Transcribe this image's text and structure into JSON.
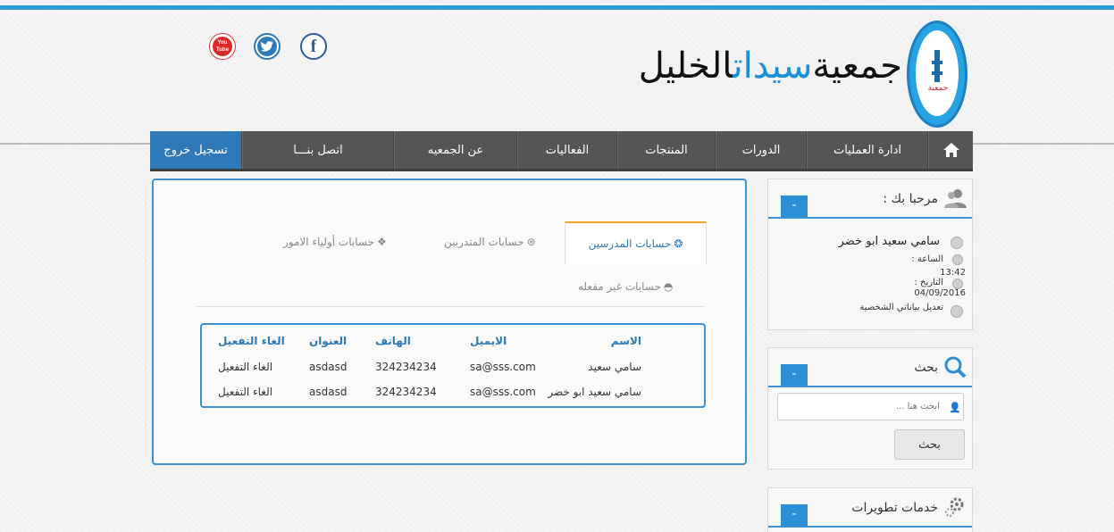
{
  "header": {
    "title_prefix": "جمعية",
    "title_accent": "سيدات",
    "title_suffix": "الخليل",
    "logo_text": "جمعية",
    "social": [
      "youtube-icon",
      "twitter-icon",
      "facebook-icon"
    ],
    "youtube_label_1": "You",
    "youtube_label_2": "Tube",
    "facebook_label": "f"
  },
  "nav": {
    "home_icon": "home-icon",
    "items": [
      "ادارة العمليات",
      "الدورات",
      "المنتجات",
      "الفعاليات",
      "عن الجمعيه",
      "اتصل بنـــا"
    ],
    "logout": "تسجيل خروج"
  },
  "colors": {
    "accent": "#2d8fd6",
    "nav_bg": "#555555",
    "tab_active_border": "#f0a32a"
  },
  "tabs": {
    "teachers": "حسابات المدرسين",
    "trainees": "حسابات المتدربين",
    "guardians": "حسابات أولياء الامور",
    "inactive": "حسابات غير مفعله"
  },
  "table": {
    "headers": {
      "name": "الاسم",
      "email": "الايميل",
      "phone": "الهاتف",
      "address": "العنوان",
      "deactivate": "الغاء التفعيل"
    },
    "rows": [
      {
        "name": "سامي سعيد",
        "email": "sa@sss.com",
        "phone": "324234234",
        "address": "asdasd",
        "deactivate": "الغاء التفعيل"
      },
      {
        "name": "سامي سعيد ابو خضر",
        "email": "sa@sss.com",
        "phone": "324234234",
        "address": "asdasd",
        "deactivate": "الغاء التفعيل"
      }
    ]
  },
  "welcome": {
    "title": "مرحبا بك :",
    "toggle": "-",
    "user_name": "سامي سعيد ابو خضر",
    "time_label": "الساعة :",
    "time_value": "13:42",
    "date_label": "التاريخ :",
    "date_value": "04/09/2016",
    "edit_link": "تعديل بياناتي الشخصية"
  },
  "search": {
    "title": "بحث",
    "toggle": "-",
    "placeholder": "ابحث هنا ...",
    "button": "بحث"
  },
  "services": {
    "title": "خدمات تطويرات",
    "toggle": "-"
  }
}
